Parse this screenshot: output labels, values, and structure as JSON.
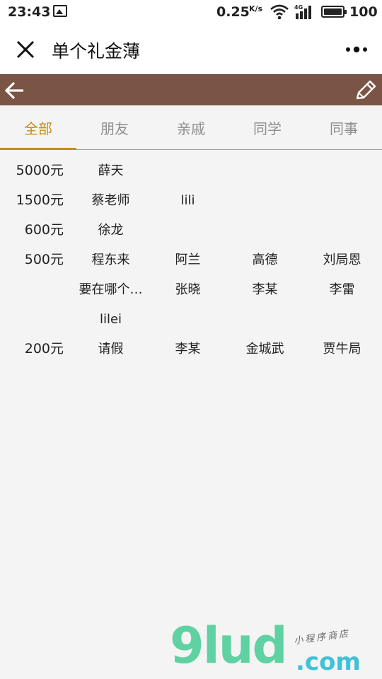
{
  "status_bar": {
    "time": "23:43",
    "speed": "0.25",
    "speed_unit": "K/s",
    "network": "4G",
    "battery": "100"
  },
  "nav": {
    "title": "单个礼金薄"
  },
  "tabs": [
    {
      "label": "全部",
      "active": true
    },
    {
      "label": "朋友",
      "active": false
    },
    {
      "label": "亲戚",
      "active": false
    },
    {
      "label": "同学",
      "active": false
    },
    {
      "label": "同事",
      "active": false
    }
  ],
  "groups": [
    {
      "amount": "5000元",
      "names": [
        "薛天"
      ]
    },
    {
      "amount": "1500元",
      "names": [
        "蔡老师",
        "lili"
      ]
    },
    {
      "amount": "600元",
      "names": [
        "徐龙"
      ]
    },
    {
      "amount": "500元",
      "names": [
        "程东来",
        "阿兰",
        "高德",
        "刘局恩",
        "要在哪个…",
        "张晓",
        "李某",
        "李雷",
        "lilei"
      ]
    },
    {
      "amount": "200元",
      "names": [
        "请假",
        "李某",
        "金城武",
        "贾牛局"
      ]
    }
  ],
  "watermark": {
    "brand": "9lud",
    "domain": ".com",
    "slogan": "小程序商店"
  },
  "colors": {
    "accent": "#c98a1e",
    "toolbar": "#7a5545",
    "background": "#f4f4f4"
  }
}
